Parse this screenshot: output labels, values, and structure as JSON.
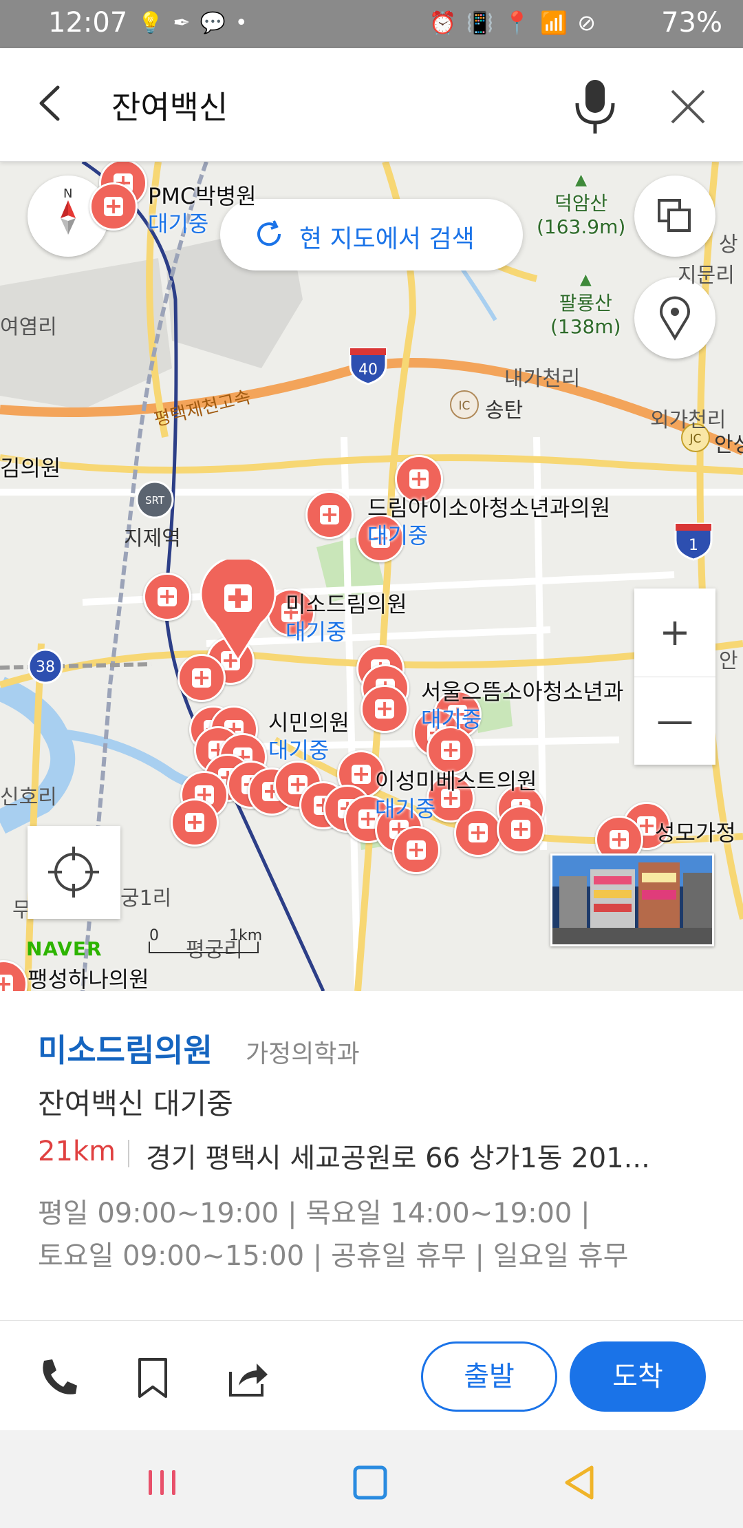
{
  "status_bar": {
    "time": "12:07",
    "left_icons": [
      "bulb-icon",
      "feather-icon",
      "talk-icon",
      "dot-icon"
    ],
    "right_icons": [
      "alarm-icon",
      "vibrate-icon",
      "location-icon",
      "wifi-icon",
      "block-icon"
    ],
    "battery": "73%"
  },
  "search": {
    "query": "잔여백신"
  },
  "map": {
    "research_label": "현 지도에서 검색",
    "labels": {
      "pmc": "PMC박병원",
      "pmc_wait": "대기중",
      "deokam": "덕암산",
      "deokam_h": "(163.9m)",
      "paryong": "팔룡산",
      "paryong_h": "(138m)",
      "yeomni": "여염리",
      "jimulli": "지문리",
      "naegacheon": "내가천리",
      "ic_songtan": "송탄",
      "oegacheon": "외가천리",
      "jc_ansung": "안성",
      "expressway": "평택제천고속",
      "jije": "지제역",
      "uiwon_left": "김의원",
      "dream_kids": "드림아이소아청소년과의원",
      "dream_kids_wait": "대기중",
      "miso_dream": "미소드림의원",
      "miso_dream_wait": "대기중",
      "seoul_top": "서울으뜸소아청소년과",
      "seoul_top_wait": "대기중",
      "simin": "시민의원",
      "simin_wait": "대기중",
      "leesungmi": "이성미베스트의원",
      "leesungmi_wait": "대기중",
      "seongmo": "성모가정",
      "sinhori": "신호리",
      "gung1ri": "궁1리",
      "pyeong_gun": "평궁리",
      "paengseong": "팽성하나의원",
      "an_right": "안",
      "sang_right": "상",
      "mu_left": "무"
    },
    "road_shields": {
      "r40": "40",
      "r38": "38",
      "r1": "1",
      "ic": "IC",
      "jc": "JC",
      "srt": "SRT"
    },
    "brand": "NAVER",
    "scale_zero": "0",
    "scale_km": "1km",
    "zoom_in": "+",
    "zoom_out": "—"
  },
  "place": {
    "name": "미소드림의원",
    "category": "가정의학과",
    "status": "잔여백신 대기중",
    "distance": "21km",
    "address": "경기 평택시 세교공원로 66 상가1동 201...",
    "hours_line1": "평일 09:00~19:00 | 목요일 14:00~19:00 |",
    "hours_line2": "토요일 09:00~15:00 | 공휴일 휴무 | 일요일 휴무"
  },
  "actions": {
    "depart": "출발",
    "arrive": "도착"
  },
  "colors": {
    "accent": "#1a73e8",
    "pin": "#f0645a",
    "distance": "#e04040"
  }
}
